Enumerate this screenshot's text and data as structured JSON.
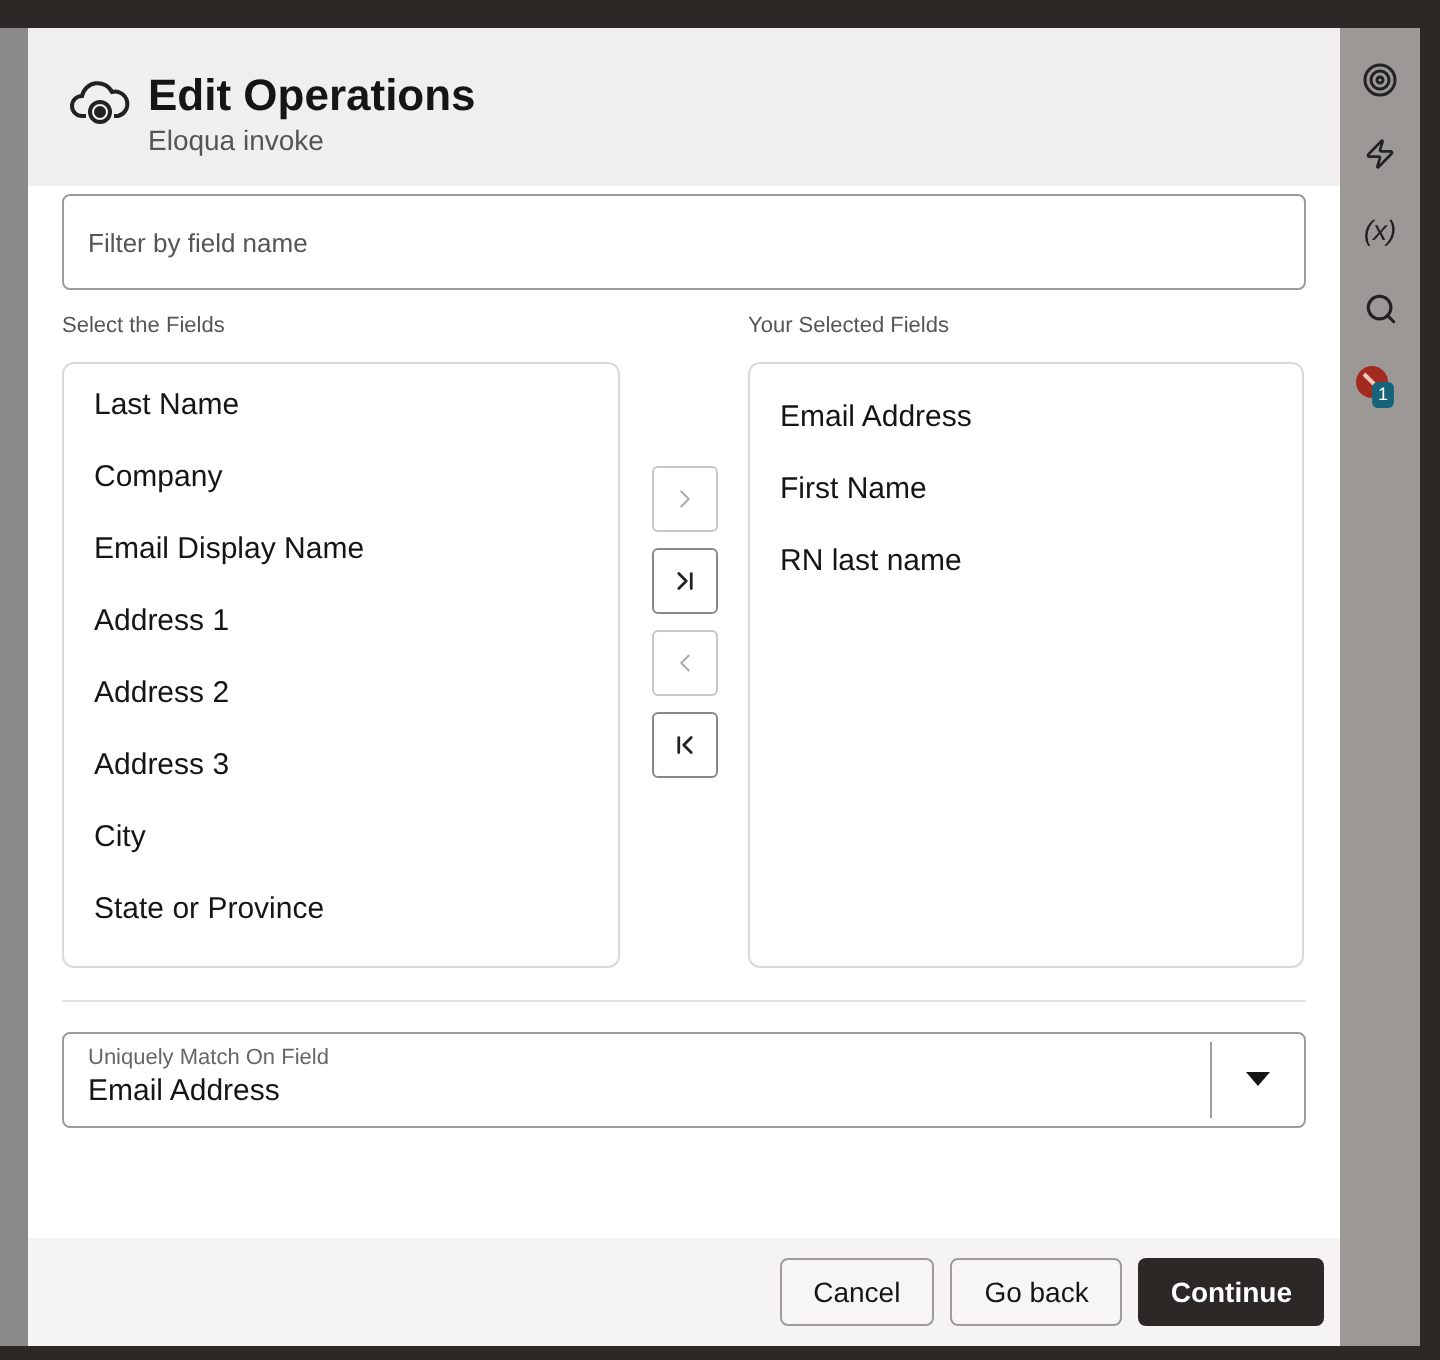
{
  "dialog": {
    "title": "Edit Operations",
    "subtitle": "Eloqua invoke"
  },
  "filter": {
    "placeholder": "Filter by field name"
  },
  "available": {
    "label": "Select the Fields",
    "items": [
      "Last Name",
      "Company",
      "Email Display Name",
      "Address 1",
      "Address 2",
      "Address 3",
      "City",
      "State or Province"
    ]
  },
  "transfer_buttons": [
    {
      "kind": "move",
      "disabled": true
    },
    {
      "kind": "move-all",
      "disabled": false
    },
    {
      "kind": "remove",
      "disabled": true
    },
    {
      "kind": "remove-all",
      "disabled": false
    }
  ],
  "selected": {
    "label": "Your Selected Fields",
    "items": [
      "Email Address",
      "First Name",
      "RN last name"
    ]
  },
  "match_field": {
    "label": "Uniquely Match On Field",
    "value": "Email Address"
  },
  "buttons": [
    {
      "label": "Cancel",
      "kind": "secondary"
    },
    {
      "label": "Go back",
      "kind": "secondary"
    },
    {
      "label": "Continue",
      "kind": "primary"
    }
  ],
  "side_rail": [
    {
      "kind": "target"
    },
    {
      "kind": "bolt"
    },
    {
      "kind": "text",
      "label": "(x)"
    },
    {
      "kind": "search"
    },
    {
      "kind": "error",
      "badge": "1"
    }
  ]
}
